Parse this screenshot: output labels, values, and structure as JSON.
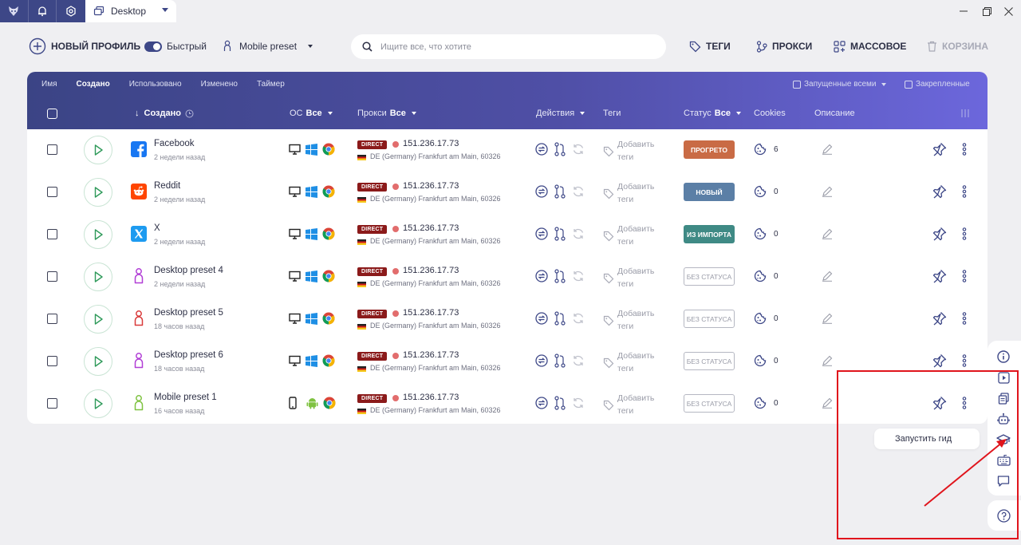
{
  "titlebar": {
    "tab_label": "Desktop",
    "icons": [
      "fox-logo-icon",
      "bell-icon",
      "gear-icon"
    ],
    "window_controls": [
      "minimize-icon",
      "maximize-icon",
      "close-icon"
    ]
  },
  "toolbar": {
    "new_profile": "НОВЫЙ ПРОФИЛЬ",
    "quick_label": "Быстрый",
    "quick_on": true,
    "preset": "Mobile preset",
    "search_placeholder": "Ищите все, что хотите",
    "tags": "ТЕГИ",
    "proxy": "ПРОКСИ",
    "bulk": "МАССОВОЕ",
    "trash": "КОРЗИНА"
  },
  "table": {
    "sort_tabs": [
      "Имя",
      "Создано",
      "Использовано",
      "Изменено",
      "Таймер"
    ],
    "active_sort": "Создано",
    "launched_all": "Запущенные всеми",
    "pinned": "Закрепленные",
    "columns": {
      "created": "Создано",
      "os": "ОС",
      "os_filter": "Все",
      "proxy": "Прокси",
      "proxy_filter": "Все",
      "actions": "Действия",
      "tags": "Теги",
      "status": "Статус",
      "status_filter": "Все",
      "cookies": "Cookies",
      "description": "Описание"
    },
    "rows": [
      {
        "name": "Facebook",
        "time": "2 недели назад",
        "icon": "facebook-icon",
        "os": "windows",
        "proxy_type": "DIRECT",
        "ip": "151.236.17.73",
        "location": "DE (Germany) Frankfurt am Main, 60326",
        "tags": "Добавить теги",
        "status": "ПРОГРЕТО",
        "status_color": "#c96b45",
        "cookies": "6"
      },
      {
        "name": "Reddit",
        "time": "2 недели назад",
        "icon": "reddit-icon",
        "os": "windows",
        "proxy_type": "DIRECT",
        "ip": "151.236.17.73",
        "location": "DE (Germany) Frankfurt am Main, 60326",
        "tags": "Добавить теги",
        "status": "НОВЫЙ",
        "status_color": "#5b7fa6",
        "cookies": "0"
      },
      {
        "name": "X",
        "time": "2 недели назад",
        "icon": "x-twitter-icon",
        "os": "windows",
        "proxy_type": "DIRECT",
        "ip": "151.236.17.73",
        "location": "DE (Germany) Frankfurt am Main, 60326",
        "tags": "Добавить теги",
        "status": "ИЗ ИМПОРТА",
        "status_color": "#3f8a85",
        "cookies": "0"
      },
      {
        "name": "Desktop preset 4",
        "time": "2 недели назад",
        "icon": "person-icon",
        "icon_color": "#b13fd6",
        "os": "windows",
        "proxy_type": "DIRECT",
        "ip": "151.236.17.73",
        "location": "DE (Germany) Frankfurt am Main, 60326",
        "tags": "Добавить теги",
        "status": "БЕЗ СТАТУСА",
        "status_color": "",
        "cookies": "0"
      },
      {
        "name": "Desktop preset 5",
        "time": "18 часов назад",
        "icon": "person-icon",
        "icon_color": "#d93b3b",
        "os": "windows",
        "proxy_type": "DIRECT",
        "ip": "151.236.17.73",
        "location": "DE (Germany) Frankfurt am Main, 60326",
        "tags": "Добавить теги",
        "status": "БЕЗ СТАТУСА",
        "status_color": "",
        "cookies": "0"
      },
      {
        "name": "Desktop preset 6",
        "time": "18 часов назад",
        "icon": "person-icon",
        "icon_color": "#b13fd6",
        "os": "windows",
        "proxy_type": "DIRECT",
        "ip": "151.236.17.73",
        "location": "DE (Germany) Frankfurt am Main, 60326",
        "tags": "Добавить теги",
        "status": "БЕЗ СТАТУСА",
        "status_color": "",
        "cookies": "0"
      },
      {
        "name": "Mobile preset 1",
        "time": "16 часов назад",
        "icon": "person-icon",
        "icon_color": "#7fc241",
        "os": "android",
        "proxy_type": "DIRECT",
        "ip": "151.236.17.73",
        "location": "DE (Germany) Frankfurt am Main, 60326",
        "tags": "Добавить теги",
        "status": "БЕЗ СТАТУСА",
        "status_color": "",
        "cookies": "0"
      }
    ]
  },
  "sidepanel": {
    "icons": [
      "info-icon",
      "video-icon",
      "copy-icon",
      "robot-icon",
      "graduation-cap-icon",
      "keyboard-icon",
      "chat-icon"
    ],
    "tooltip": "Запустить гид",
    "help_icon": "help-icon"
  },
  "annotation": {
    "color": "#e0141c"
  },
  "colors": {
    "brand": "#3d4787",
    "accent": "#6c67dc",
    "proxy_badge": "#8b1a1a"
  }
}
